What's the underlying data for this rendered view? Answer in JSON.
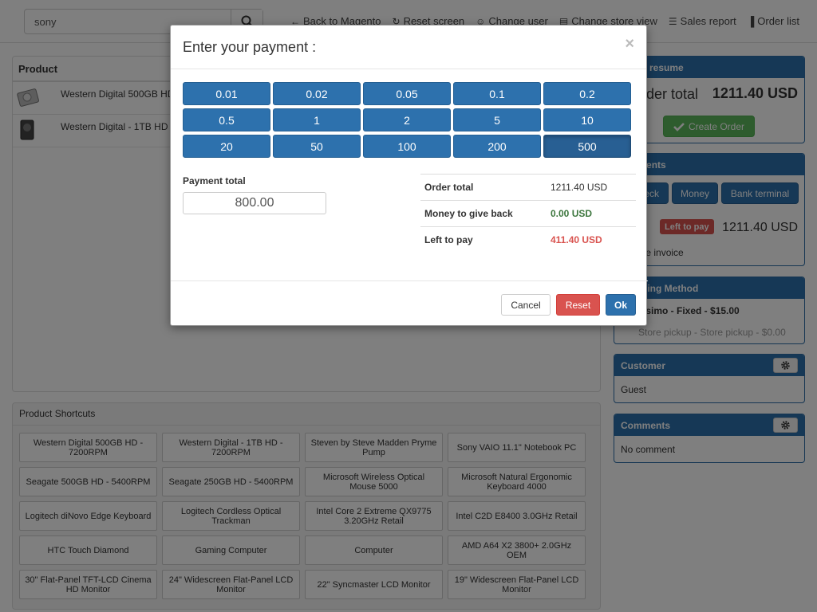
{
  "search": {
    "value": "sony"
  },
  "nav": [
    {
      "icon": "arrow-left-icon",
      "glyph": "←",
      "label": "Back to Magento"
    },
    {
      "icon": "refresh-icon",
      "glyph": "↻",
      "label": "Reset screen"
    },
    {
      "icon": "user-icon",
      "glyph": "☺",
      "label": "Change user"
    },
    {
      "icon": "store-icon",
      "glyph": "▤",
      "label": "Change store view"
    },
    {
      "icon": "list-icon",
      "glyph": "☰",
      "label": "Sales report"
    },
    {
      "icon": "bar-chart-icon",
      "glyph": "▐",
      "label": "Order list"
    }
  ],
  "products": {
    "header": "Product",
    "rows": [
      {
        "name": "Western Digital 500GB HD - 7200RPM"
      },
      {
        "name": "Western Digital - 1TB HD - 7200RPM"
      }
    ]
  },
  "shortcuts": {
    "title": "Product Shortcuts",
    "items": [
      "Western Digital 500GB HD - 7200RPM",
      "Western Digital - 1TB HD - 7200RPM",
      "Steven by Steve Madden Pryme Pump",
      "Sony VAIO 11.1\" Notebook PC",
      "Seagate 500GB HD - 5400RPM",
      "Seagate 250GB HD - 5400RPM",
      "Microsoft Wireless Optical Mouse 5000",
      "Microsoft Natural Ergonomic Keyboard 4000",
      "Logitech diNovo Edge Keyboard",
      "Logitech Cordless Optical Trackman",
      "Intel Core 2 Extreme QX9775 3.20GHz Retail",
      "Intel C2D E8400 3.0GHz Retail",
      "HTC Touch Diamond",
      "Gaming Computer",
      "Computer",
      "AMD A64 X2 3800+ 2.0GHz OEM",
      "30\" Flat-Panel TFT-LCD Cinema HD Monitor",
      "24\" Widescreen Flat-Panel LCD Monitor",
      "22\" Syncmaster LCD Monitor",
      "19\" Widescreen Flat-Panel LCD Monitor"
    ]
  },
  "resume": {
    "title": "Order resume",
    "total_label": "Order total",
    "total_value": "1211.40 USD",
    "create_label": "Create Order"
  },
  "payments": {
    "title": "Payments",
    "methods": [
      "Check",
      "Money",
      "Bank terminal"
    ],
    "left_label": "Left to pay",
    "left_value": "1211.40 USD",
    "invoice_label": "Create invoice"
  },
  "shipping": {
    "title": "Shipping Method",
    "option_1": "Colissimo - Fixed - $15.00",
    "option_2": "Store pickup - Store pickup - $0.00"
  },
  "customer": {
    "title": "Customer",
    "value": "Guest"
  },
  "comments": {
    "title": "Comments",
    "value": "No comment"
  },
  "modal": {
    "title": "Enter your payment :",
    "close": "×",
    "coins": [
      "0.01",
      "0.02",
      "0.05",
      "0.1",
      "0.2",
      "0.5",
      "1",
      "2",
      "5",
      "10",
      "20",
      "50",
      "100",
      "200",
      "500"
    ],
    "active_coin": "500",
    "payment_total_label": "Payment total",
    "payment_total_value": "800.00",
    "summary": [
      {
        "label": "Order total",
        "value": "1211.40 USD",
        "tone": "normal"
      },
      {
        "label": "Money to give back",
        "value": "0.00 USD",
        "tone": "green"
      },
      {
        "label": "Left to pay",
        "value": "411.40 USD",
        "tone": "red"
      }
    ],
    "cancel_label": "Cancel",
    "reset_label": "Reset",
    "ok_label": "Ok"
  },
  "colors": {
    "primary": "#2d71ad",
    "success": "#5cb85c",
    "danger": "#d9534f",
    "overlay": "rgba(0,0,0,0.5)"
  }
}
